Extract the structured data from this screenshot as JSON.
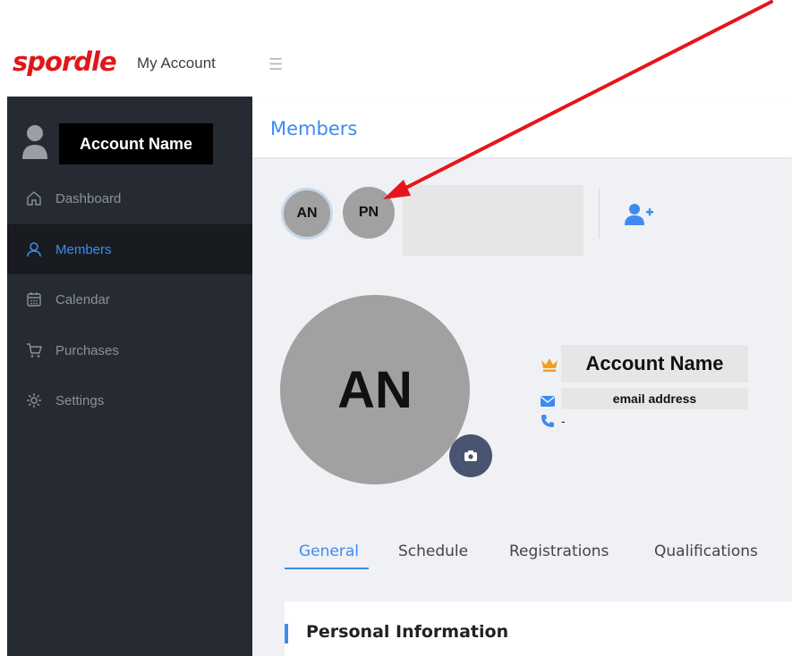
{
  "header": {
    "brand": "spordle",
    "app_title": "My Account",
    "menu_icon": "hamburger-icon",
    "brand_color": "#e0161b"
  },
  "sidebar": {
    "account_name": "Account Name",
    "avatar_icon": "user-avatar-icon",
    "items": [
      {
        "label": "Dashboard",
        "icon": "home-icon",
        "active": false
      },
      {
        "label": "Members",
        "icon": "user-icon",
        "active": true
      },
      {
        "label": "Calendar",
        "icon": "calendar-icon",
        "active": false
      },
      {
        "label": "Purchases",
        "icon": "cart-icon",
        "active": false
      },
      {
        "label": "Settings",
        "icon": "gear-icon",
        "active": false
      }
    ],
    "bg_color": "#262b33",
    "active_color": "#3d8bf0"
  },
  "main": {
    "page_title": "Members",
    "member_chips": [
      "AN",
      "PN"
    ],
    "add_member_icon": "add-user-icon",
    "profile": {
      "initials": "AN",
      "name": "Account Name",
      "email": "email address",
      "phone": "-",
      "camera_icon": "camera-icon",
      "crown_icon": "crown-icon",
      "mail_icon": "mail-icon",
      "phone_icon": "phone-icon"
    },
    "tabs": [
      {
        "label": "General",
        "active": true
      },
      {
        "label": "Schedule",
        "active": false
      },
      {
        "label": "Registrations",
        "active": false
      },
      {
        "label": "Qualifications",
        "active": false
      }
    ],
    "section_title": "Personal Information"
  },
  "annotation": {
    "arrow_color": "#e8141b"
  }
}
